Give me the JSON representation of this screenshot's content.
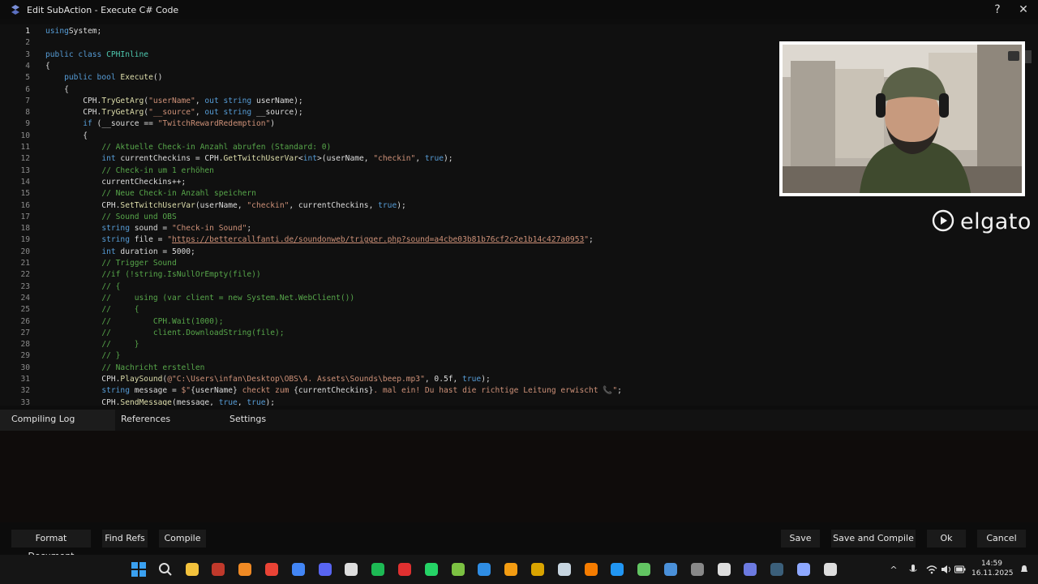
{
  "window": {
    "title": "Edit SubAction - Execute C# Code",
    "help_label": "?",
    "close_label": "✕"
  },
  "code_lines": [
    {
      "n": "1",
      "parts": [
        [
          "kw",
          "using"
        ],
        [
          "",
          "System;"
        ]
      ]
    },
    {
      "n": "2",
      "parts": []
    },
    {
      "n": "3",
      "parts": [
        [
          "kw",
          "public class "
        ],
        [
          "ty",
          "CPHInline"
        ]
      ]
    },
    {
      "n": "4",
      "parts": [
        [
          "",
          "{"
        ]
      ]
    },
    {
      "n": "5",
      "parts": [
        [
          "",
          "    "
        ],
        [
          "kw",
          "public bool "
        ],
        [
          "fn",
          "Execute"
        ],
        [
          "",
          "()"
        ]
      ]
    },
    {
      "n": "6",
      "parts": [
        [
          "",
          "    {"
        ]
      ]
    },
    {
      "n": "7",
      "parts": [
        [
          "",
          "        CPH."
        ],
        [
          "fn",
          "TryGetArg"
        ],
        [
          "",
          "("
        ],
        [
          "str",
          "\"userName\""
        ],
        [
          "",
          ", "
        ],
        [
          "kw",
          "out string "
        ],
        [
          "",
          "userName);"
        ]
      ]
    },
    {
      "n": "8",
      "parts": [
        [
          "",
          "        CPH."
        ],
        [
          "fn",
          "TryGetArg"
        ],
        [
          "",
          "("
        ],
        [
          "str",
          "\"__source\""
        ],
        [
          "",
          ", "
        ],
        [
          "kw",
          "out string "
        ],
        [
          "",
          "__source);"
        ]
      ]
    },
    {
      "n": "9",
      "parts": [
        [
          "",
          "        "
        ],
        [
          "kw",
          "if"
        ],
        [
          "",
          " (__source == "
        ],
        [
          "str",
          "\"TwitchRewardRedemption\""
        ],
        [
          "",
          ")"
        ]
      ]
    },
    {
      "n": "10",
      "parts": [
        [
          "",
          "        {"
        ]
      ]
    },
    {
      "n": "11",
      "parts": [
        [
          "",
          "            "
        ],
        [
          "cm",
          "// Aktuelle Check-in Anzahl abrufen (Standard: 0)"
        ]
      ]
    },
    {
      "n": "12",
      "parts": [
        [
          "",
          "            "
        ],
        [
          "kw",
          "int "
        ],
        [
          "",
          "currentCheckins = CPH."
        ],
        [
          "fn",
          "GetTwitchUserVar"
        ],
        [
          "",
          "<"
        ],
        [
          "kw",
          "int"
        ],
        [
          "",
          ">(userName, "
        ],
        [
          "str",
          "\"checkin\""
        ],
        [
          "",
          ", "
        ],
        [
          "kw",
          "true"
        ],
        [
          "",
          ");"
        ]
      ]
    },
    {
      "n": "13",
      "parts": [
        [
          "",
          "            "
        ],
        [
          "cm",
          "// Check-in um 1 erhöhen"
        ]
      ]
    },
    {
      "n": "14",
      "parts": [
        [
          "",
          "            currentCheckins++;"
        ]
      ]
    },
    {
      "n": "15",
      "parts": [
        [
          "",
          "            "
        ],
        [
          "cm",
          "// Neue Check-in Anzahl speichern"
        ]
      ]
    },
    {
      "n": "16",
      "parts": [
        [
          "",
          "            CPH."
        ],
        [
          "fn",
          "SetTwitchUserVar"
        ],
        [
          "",
          "(userName, "
        ],
        [
          "str",
          "\"checkin\""
        ],
        [
          "",
          ", currentCheckins, "
        ],
        [
          "kw",
          "true"
        ],
        [
          "",
          ");"
        ]
      ]
    },
    {
      "n": "17",
      "parts": [
        [
          "",
          "            "
        ],
        [
          "cm",
          "// Sound und OBS"
        ]
      ]
    },
    {
      "n": "18",
      "parts": [
        [
          "",
          "            "
        ],
        [
          "kw",
          "string "
        ],
        [
          "",
          "sound = "
        ],
        [
          "str",
          "\"Check-in Sound\""
        ],
        [
          "",
          ";"
        ]
      ]
    },
    {
      "n": "19",
      "parts": [
        [
          "",
          "            "
        ],
        [
          "kw",
          "string "
        ],
        [
          "",
          "file = "
        ],
        [
          "str",
          "\""
        ],
        [
          "url",
          "https://bettercallfanti.de/soundonweb/trigger.php?sound=a4cbe03b81b76cf2c2e1b14c427a0953"
        ],
        [
          "str",
          "\""
        ],
        [
          "",
          ";"
        ]
      ]
    },
    {
      "n": "20",
      "parts": [
        [
          "",
          "            "
        ],
        [
          "kw",
          "int "
        ],
        [
          "",
          "duration = 5000;"
        ]
      ]
    },
    {
      "n": "21",
      "parts": [
        [
          "",
          "            "
        ],
        [
          "cm",
          "// Trigger Sound"
        ]
      ]
    },
    {
      "n": "22",
      "parts": [
        [
          "",
          "            "
        ],
        [
          "cm",
          "//if (!string.IsNullOrEmpty(file))"
        ]
      ]
    },
    {
      "n": "23",
      "parts": [
        [
          "",
          "            "
        ],
        [
          "cm",
          "// {"
        ]
      ]
    },
    {
      "n": "24",
      "parts": [
        [
          "",
          "            "
        ],
        [
          "cm",
          "//     using (var client = new System.Net.WebClient())"
        ]
      ]
    },
    {
      "n": "25",
      "parts": [
        [
          "",
          "            "
        ],
        [
          "cm",
          "//     {"
        ]
      ]
    },
    {
      "n": "26",
      "parts": [
        [
          "",
          "            "
        ],
        [
          "cm",
          "//         CPH.Wait(1000);"
        ]
      ]
    },
    {
      "n": "27",
      "parts": [
        [
          "",
          "            "
        ],
        [
          "cm",
          "//         client.DownloadString(file);"
        ]
      ]
    },
    {
      "n": "28",
      "parts": [
        [
          "",
          "            "
        ],
        [
          "cm",
          "//     }"
        ]
      ]
    },
    {
      "n": "29",
      "parts": [
        [
          "",
          "            "
        ],
        [
          "cm",
          "// }"
        ]
      ]
    },
    {
      "n": "30",
      "parts": [
        [
          "",
          "            "
        ],
        [
          "cm",
          "// Nachricht erstellen"
        ]
      ]
    },
    {
      "n": "31",
      "parts": [
        [
          "",
          "            CPH."
        ],
        [
          "fn",
          "PlaySound"
        ],
        [
          "",
          "("
        ],
        [
          "str",
          "@\"C:\\Users\\infan\\Desktop\\OBS\\4. Assets\\Sounds\\beep.mp3\""
        ],
        [
          "",
          ", 0.5f, "
        ],
        [
          "kw",
          "true"
        ],
        [
          "",
          ");"
        ]
      ]
    },
    {
      "n": "32",
      "parts": [
        [
          "",
          "            "
        ],
        [
          "kw",
          "string "
        ],
        [
          "",
          "message = "
        ],
        [
          "str",
          "$\""
        ],
        [
          "",
          "{userName}"
        ],
        [
          "str",
          " checkt zum "
        ],
        [
          "",
          "{currentCheckins}"
        ],
        [
          "str",
          ". mal ein! Du hast die richtige Leitung erwischt 📞\""
        ],
        [
          "",
          ";"
        ]
      ]
    },
    {
      "n": "33",
      "parts": [
        [
          "",
          "            CPH."
        ],
        [
          "fn",
          "SendMessage"
        ],
        [
          "",
          "(message, "
        ],
        [
          "kw",
          "true"
        ],
        [
          "",
          ", "
        ],
        [
          "kw",
          "true"
        ],
        [
          "",
          ");"
        ]
      ]
    }
  ],
  "brand": {
    "text": "elgato"
  },
  "tabs": {
    "compiling_log": "Compiling Log",
    "references": "References",
    "settings": "Settings"
  },
  "buttons": {
    "format_document": "Format Document",
    "find_refs": "Find Refs",
    "compile": "Compile",
    "save": "Save",
    "save_and_compile": "Save and Compile",
    "ok": "Ok",
    "cancel": "Cancel"
  },
  "taskbar": {
    "apps": [
      "start-icon",
      "search-icon",
      "file-explorer-icon",
      "filezilla-icon",
      "vlc-icon",
      "chrome-icon",
      "chrome-profile-icon",
      "discord-icon",
      "epic-games-icon",
      "spotify-icon",
      "streamdeck-icon",
      "whatsapp-icon",
      "editor-icon",
      "vscode-icon",
      "app-icon",
      "rockstar-icon",
      "steam-icon",
      "xampp-icon",
      "capture-icon",
      "minecraft-icon",
      "app-icon-2",
      "network-tool-icon",
      "obs-icon",
      "streamerbot-icon",
      "app-icon-3",
      "audio-tool-icon",
      "app-icon-4"
    ],
    "time": "14:59",
    "date": "16.11.2025"
  },
  "colors": {
    "keyword": "#569cd6",
    "function": "#dcdcaa",
    "string": "#ce9178",
    "comment": "#57a64a",
    "type": "#4ec9b0"
  }
}
